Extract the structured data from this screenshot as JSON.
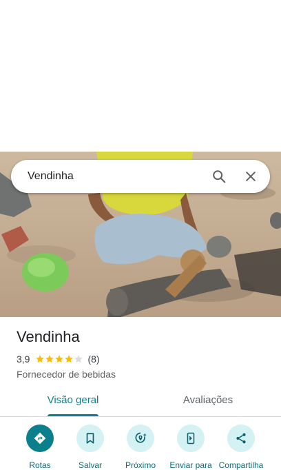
{
  "search": {
    "query": "Vendinha"
  },
  "icons": {
    "search": "search-icon",
    "close": "close-icon"
  },
  "place": {
    "name": "Vendinha",
    "rating": "3,9",
    "rating_value": 3.9,
    "review_count": "(8)",
    "category": "Fornecedor de bebidas"
  },
  "tabs": [
    {
      "label": "Visão geral",
      "active": true
    },
    {
      "label": "Avaliações",
      "active": false
    }
  ],
  "actions": [
    {
      "label": "Rotas",
      "icon": "directions-icon"
    },
    {
      "label": "Salvar",
      "icon": "bookmark-icon"
    },
    {
      "label": "Próximo",
      "icon": "nearby-icon"
    },
    {
      "label": "Enviar para",
      "icon": "send-to-phone-icon"
    },
    {
      "label": "Compartilha",
      "icon": "share-icon"
    }
  ],
  "colors": {
    "accent": "#137e8a",
    "primary_action": "#0b7f8c",
    "action_bg": "#d4f1f4",
    "star": "#fbbc04"
  }
}
